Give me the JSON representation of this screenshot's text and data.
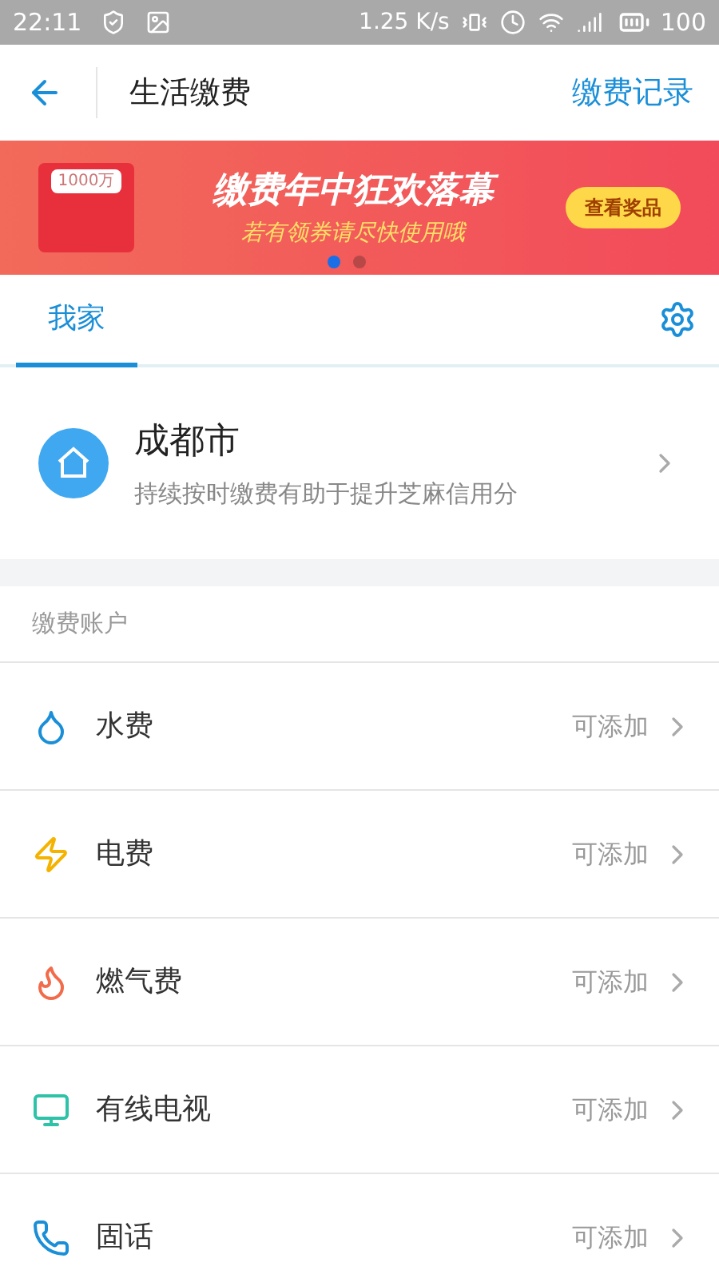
{
  "status_bar": {
    "time": "22:11",
    "speed": "1.25 K/s",
    "battery": "100"
  },
  "header": {
    "title": "生活缴费",
    "action": "缴费记录"
  },
  "banner": {
    "badge": "1000万",
    "headline": "缴费年中狂欢落幕",
    "subline": "若有领券请尽快使用哦",
    "button": "查看奖品",
    "dots": [
      {
        "selected": true
      },
      {
        "selected": false
      }
    ]
  },
  "tabs": [
    {
      "label": "我家",
      "selected": true
    }
  ],
  "home": {
    "city": "成都市",
    "note": "持续按时缴费有助于提升芝麻信用分"
  },
  "section_label": "缴费账户",
  "accounts": [
    {
      "kind": "water",
      "name": "水费",
      "status": "可添加"
    },
    {
      "kind": "electric",
      "name": "电费",
      "status": "可添加"
    },
    {
      "kind": "gas",
      "name": "燃气费",
      "status": "可添加"
    },
    {
      "kind": "tv",
      "name": "有线电视",
      "status": "可添加"
    },
    {
      "kind": "phone",
      "name": "固话",
      "status": "可添加"
    }
  ]
}
